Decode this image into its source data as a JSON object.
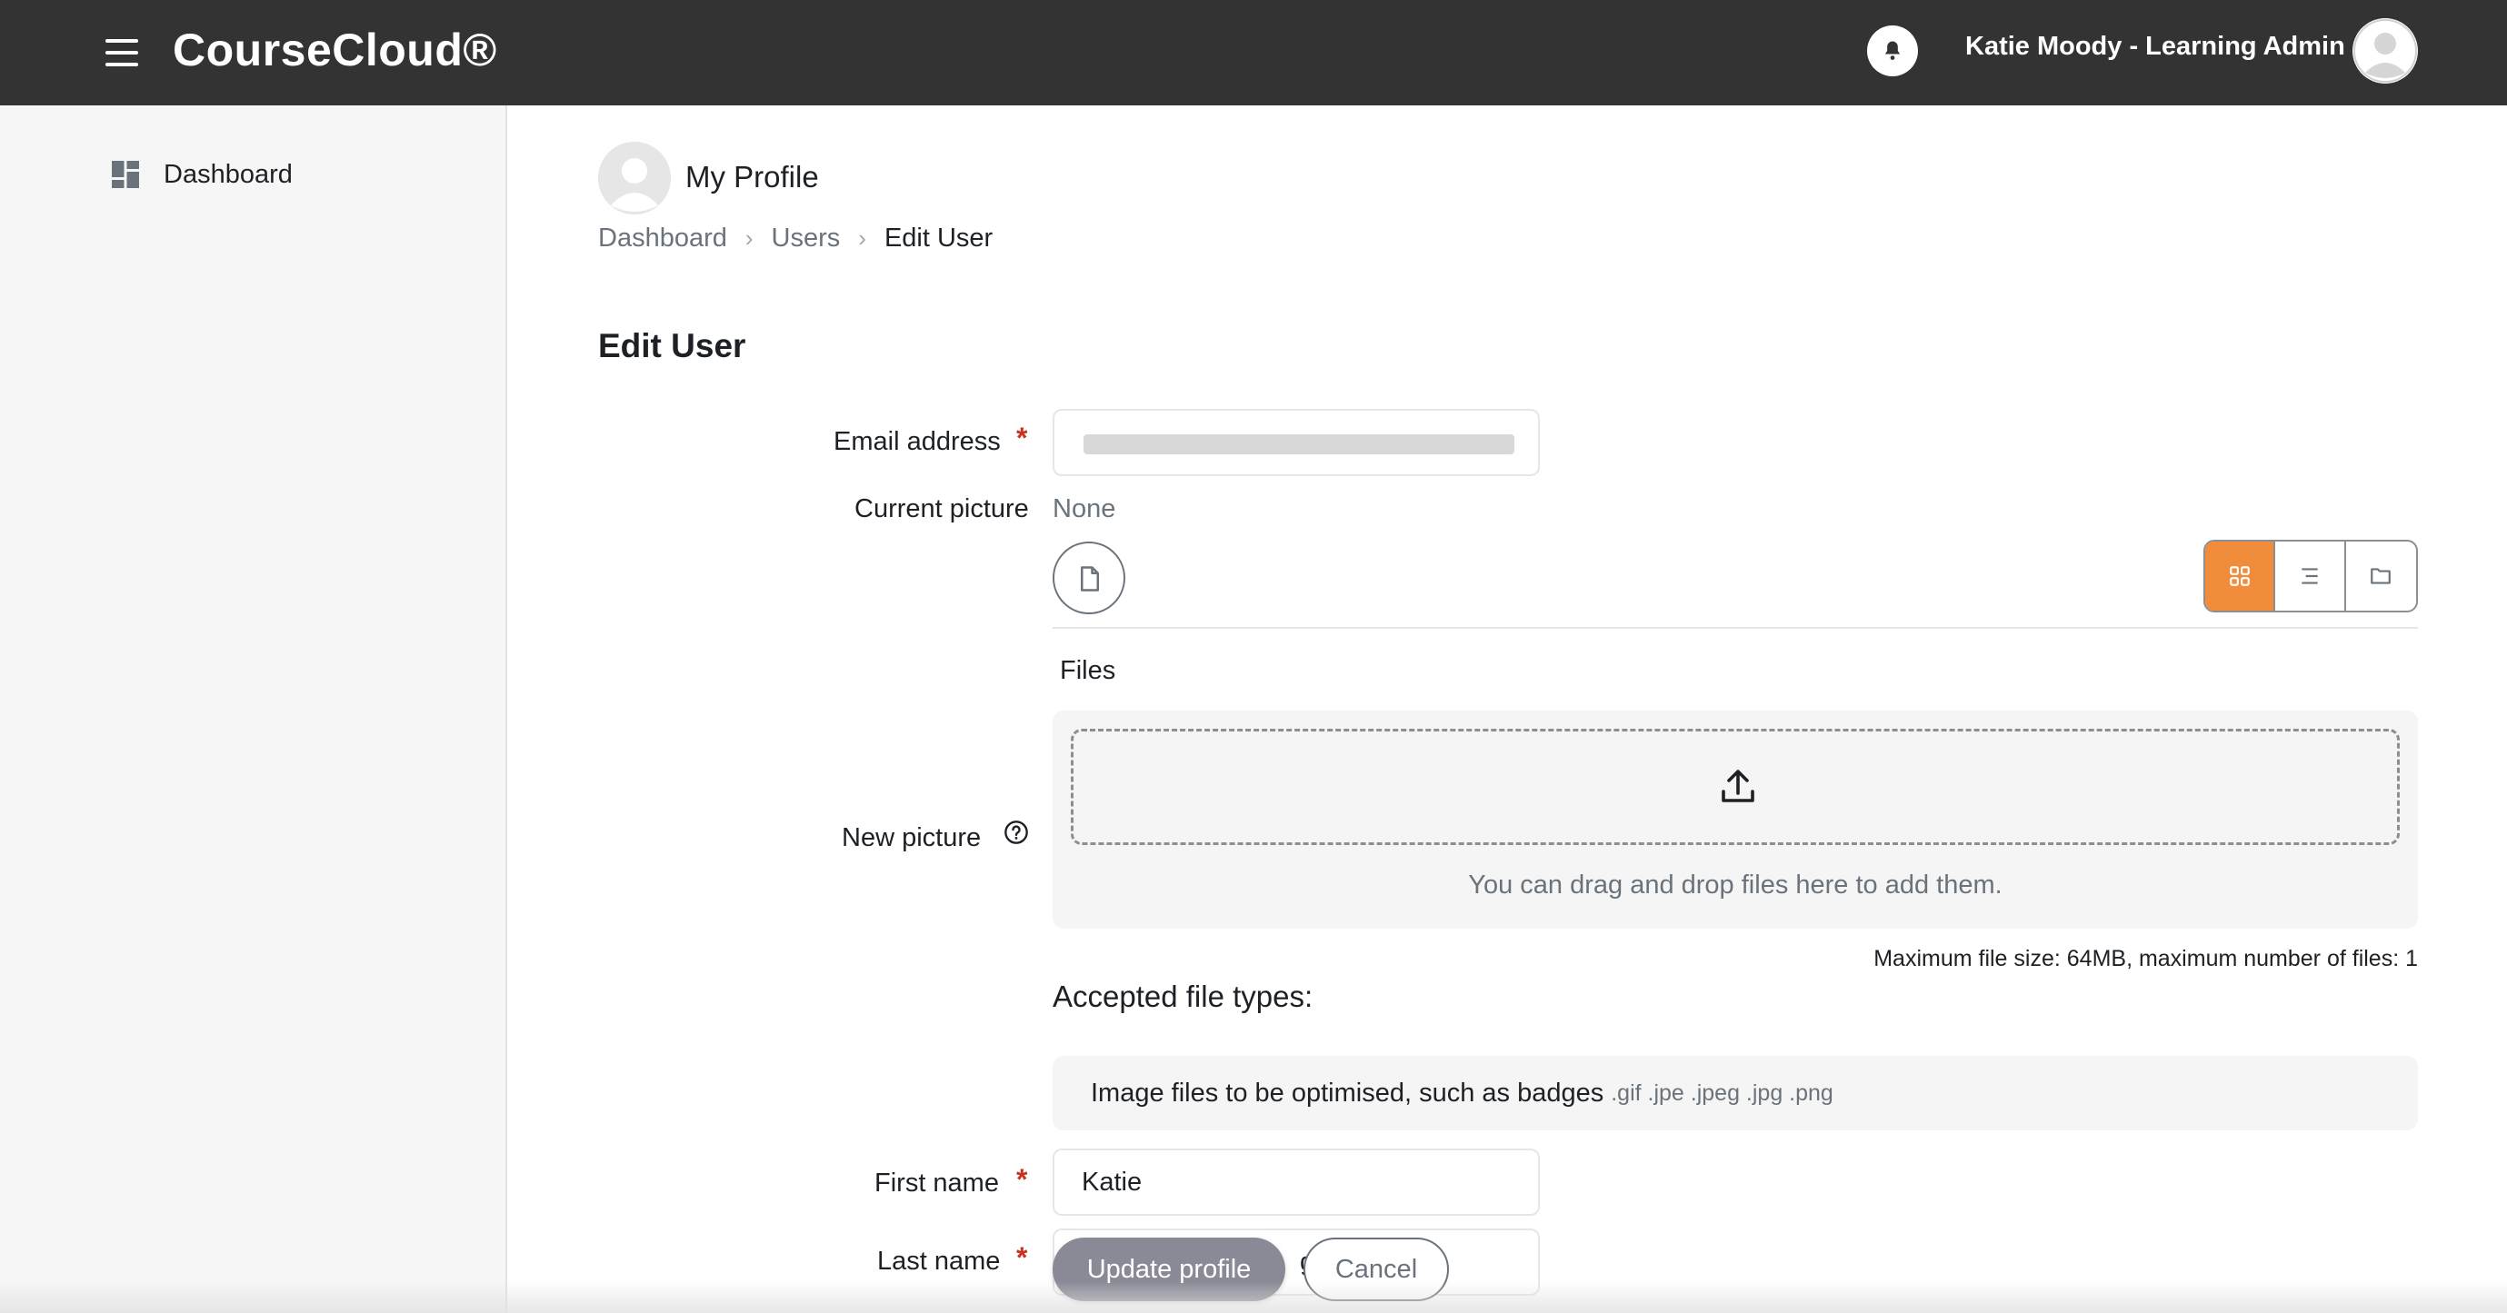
{
  "app": {
    "brand": "CourseCloud®",
    "user_name": "Katie Moody - Learning Admin"
  },
  "sidebar": {
    "items": [
      {
        "label": "Dashboard",
        "icon": "dashboard-icon"
      }
    ]
  },
  "header": {
    "title": "My Profile",
    "breadcrumb": [
      "Dashboard",
      "Users",
      "Edit User"
    ]
  },
  "form": {
    "title": "Edit User",
    "email_label": "Email address",
    "current_picture_label": "Current picture",
    "current_picture_value": "None",
    "new_picture_label": "New picture",
    "files_label": "Files",
    "drop_text": "You can drag and drop files here to add them.",
    "max_size_text": "Maximum file size: 64MB, maximum number of files: 1",
    "accepted_title": "Accepted file types:",
    "accepted_type_name": "Image files to be optimised, such as badges",
    "accepted_type_ext": ".gif .jpe .jpeg .jpg .png",
    "first_name_label": "First name",
    "first_name_value": "Katie",
    "last_name_label": "Last name",
    "last_name_value": "g",
    "required_mark": "*"
  },
  "buttons": {
    "update": "Update profile",
    "cancel": "Cancel"
  },
  "colors": {
    "topbar": "#333333",
    "accent": "#f08c3a",
    "required": "#ca3120",
    "primary_button": "#8a8a96"
  }
}
